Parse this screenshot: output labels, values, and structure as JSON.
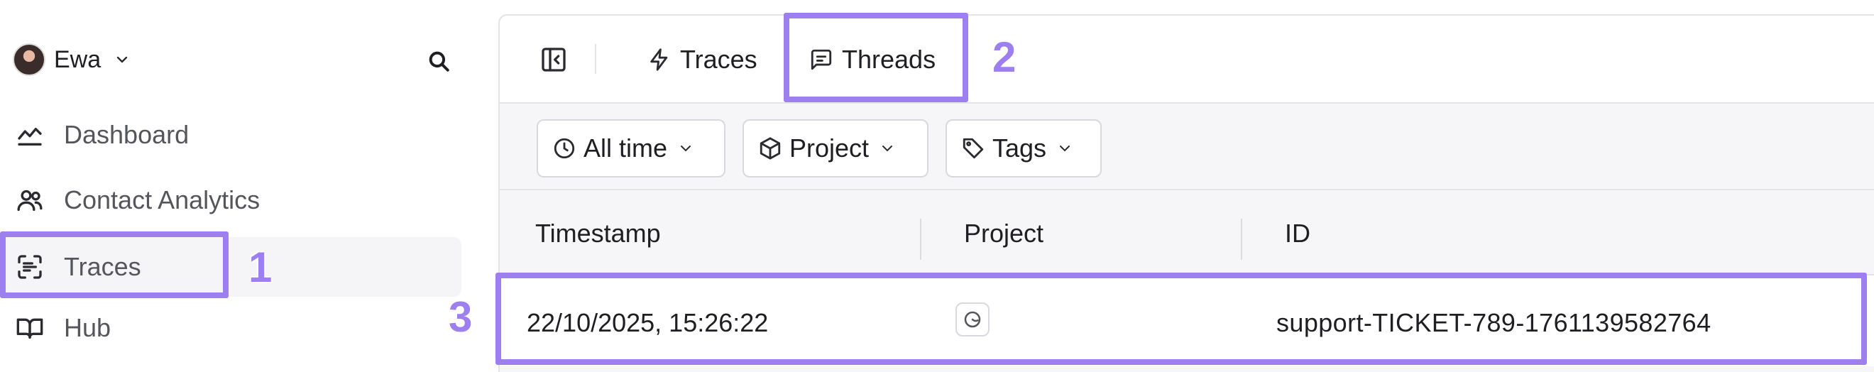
{
  "sidebar": {
    "user_name": "Ewa",
    "items": [
      {
        "label": "Dashboard",
        "icon": "chart-line-icon"
      },
      {
        "label": "Contact Analytics",
        "icon": "users-icon"
      },
      {
        "label": "Traces",
        "icon": "scan-text-icon",
        "active": true
      },
      {
        "label": "Hub",
        "icon": "book-open-icon"
      }
    ]
  },
  "toolbar": {
    "tabs": [
      {
        "label": "Traces",
        "icon": "zap-icon"
      },
      {
        "label": "Threads",
        "icon": "message-square-icon",
        "selected": true
      }
    ]
  },
  "filters": [
    {
      "label": "All time",
      "icon": "clock-icon"
    },
    {
      "label": "Project",
      "icon": "box-icon"
    },
    {
      "label": "Tags",
      "icon": "tag-icon"
    }
  ],
  "table": {
    "columns": [
      "Timestamp",
      "Project",
      "ID"
    ],
    "rows": [
      {
        "timestamp": "22/10/2025, 15:26:22",
        "id": "support-TICKET-789-1761139582764"
      }
    ]
  },
  "annotations": [
    "1",
    "2",
    "3"
  ],
  "colors": {
    "accent": "#9d7ff0",
    "active_item_bg": "#f5f5f7",
    "panel_bg": "#f6f6f8",
    "border": "#e4e4e8"
  }
}
